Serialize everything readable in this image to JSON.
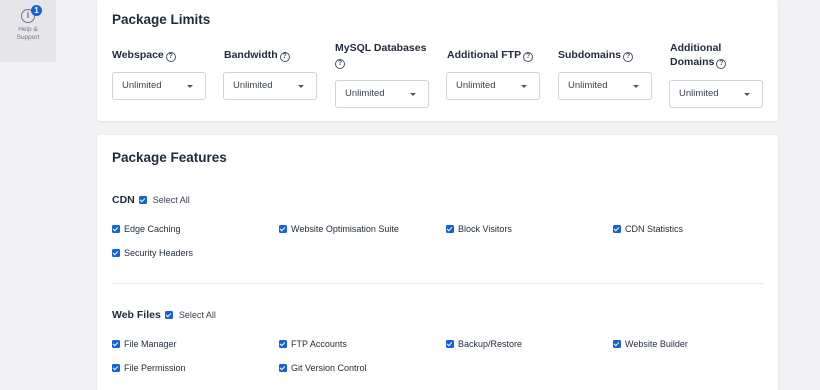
{
  "help": {
    "badge": "1",
    "label": "Help & Support",
    "icon": "info-icon"
  },
  "limits": {
    "title": "Package Limits",
    "items": [
      {
        "label": "Webspace",
        "value": "Unlimited"
      },
      {
        "label": "Bandwidth",
        "value": "Unlimited"
      },
      {
        "label": "MySQL Databases",
        "value": "Unlimited"
      },
      {
        "label": "Additional FTP",
        "value": "Unlimited"
      },
      {
        "label": "Subdomains",
        "value": "Unlimited"
      },
      {
        "label": "Additional Domains",
        "value": "Unlimited"
      }
    ]
  },
  "features": {
    "title": "Package Features",
    "sections": [
      {
        "name": "CDN",
        "select_all": "Select All",
        "items": [
          "Edge Caching",
          "Website Optimisation Suite",
          "Block Visitors",
          "CDN Statistics",
          "Security Headers"
        ]
      },
      {
        "name": "Web Files",
        "select_all": "Select All",
        "items": [
          "File Manager",
          "FTP Accounts",
          "Backup/Restore",
          "Website Builder",
          "File Permission",
          "Git Version Control"
        ]
      }
    ]
  },
  "colors": {
    "accent": "#1463d6",
    "background": "#f2f2f4",
    "card": "#ffffff"
  }
}
